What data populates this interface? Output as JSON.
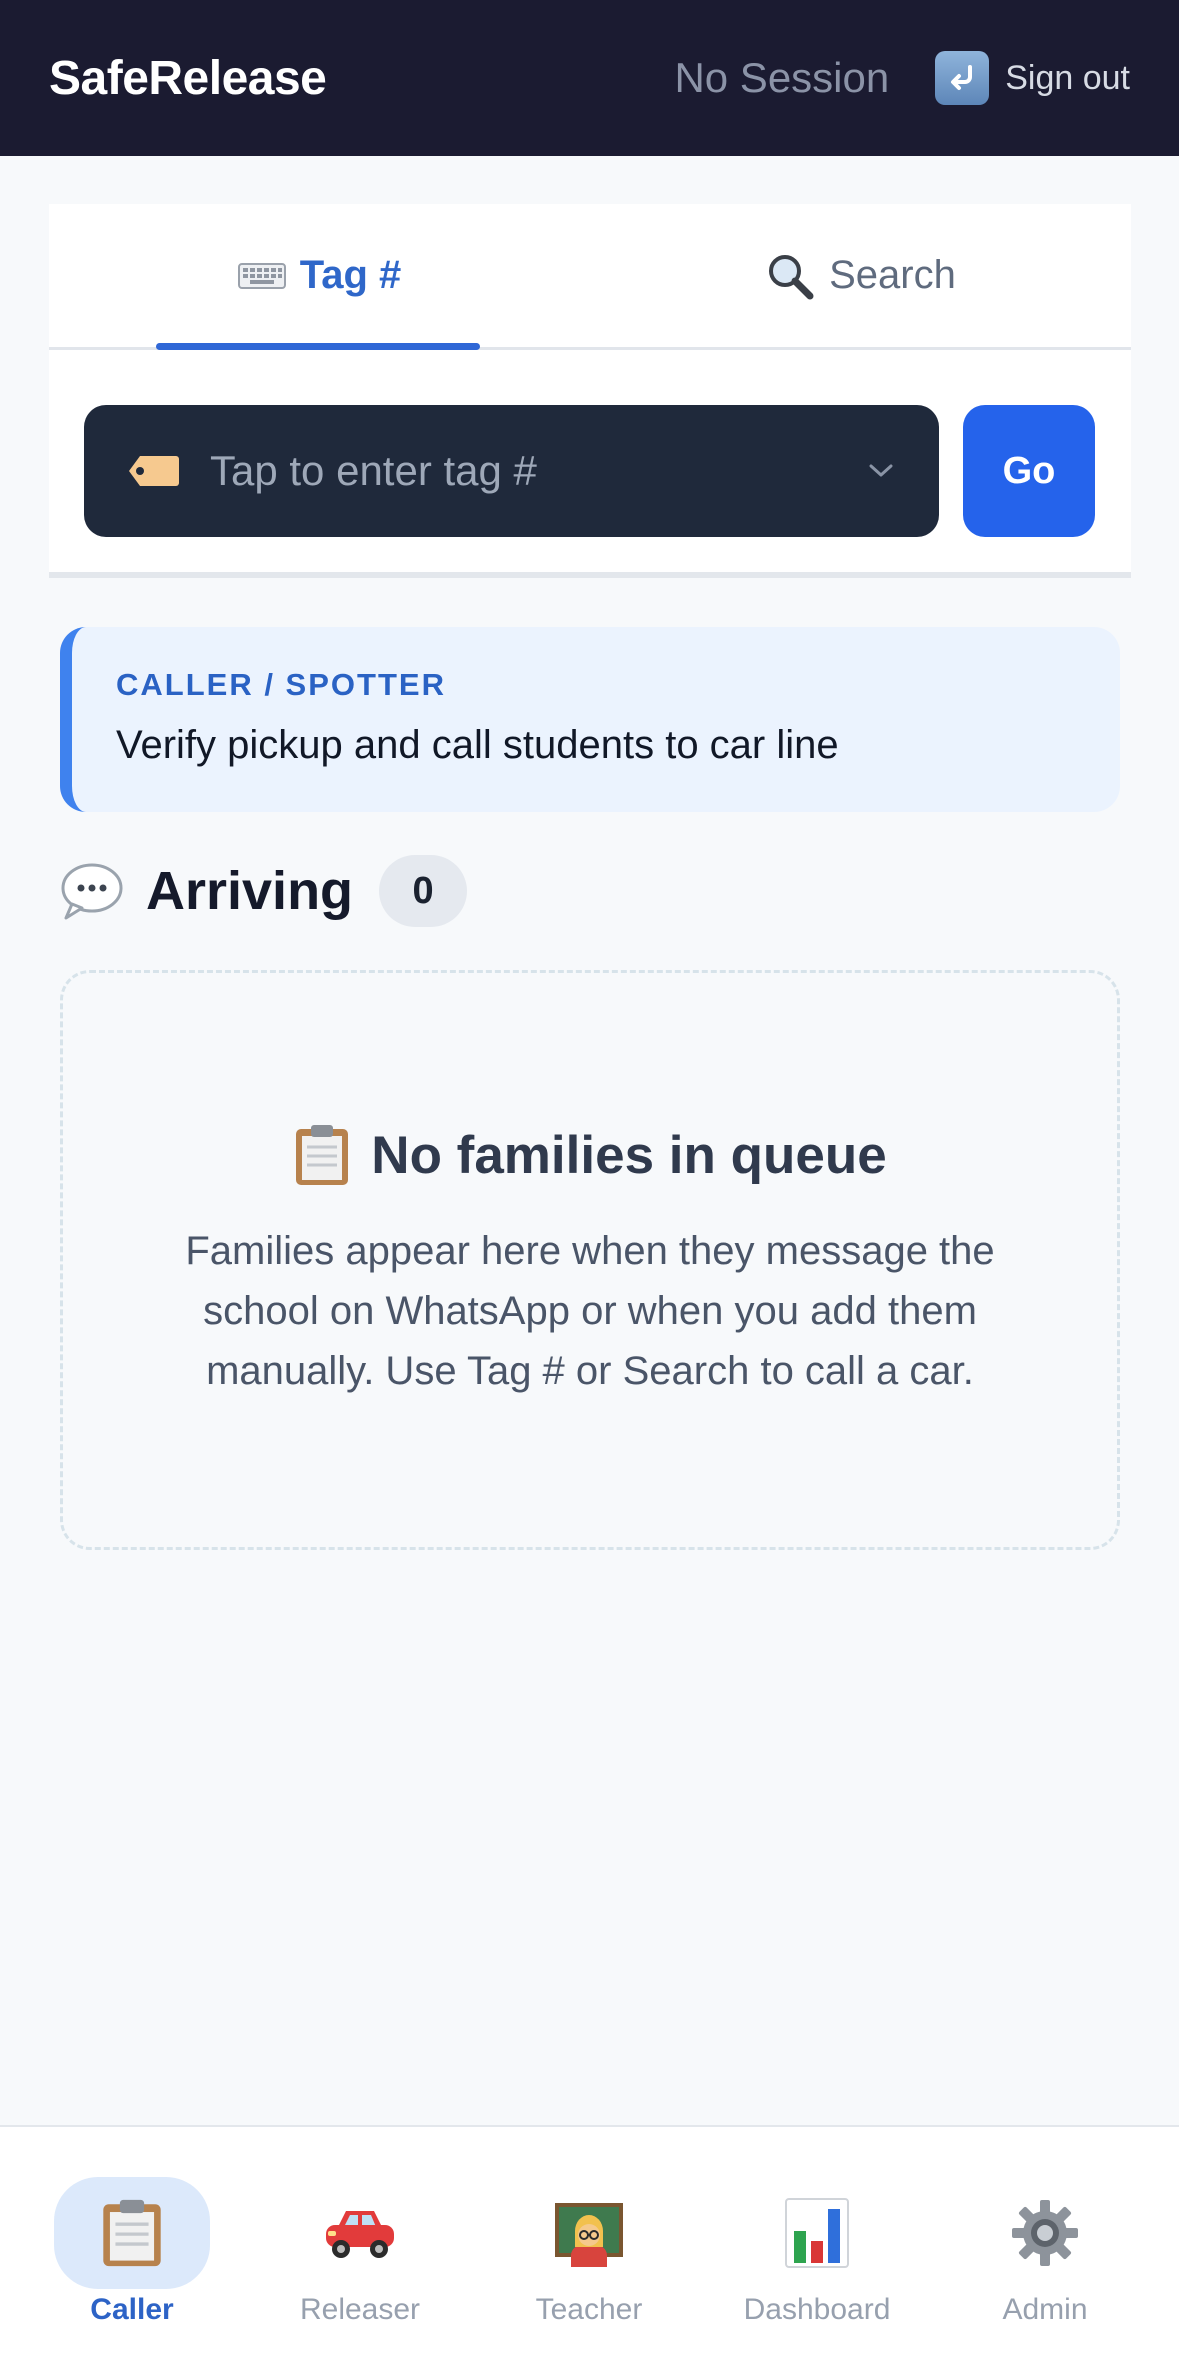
{
  "header": {
    "app_title": "SafeRelease",
    "session_status": "No Session",
    "signout_label": "Sign out",
    "signout_icon": "return-arrow-icon"
  },
  "tabs": [
    {
      "label": "Tag #",
      "icon": "keyboard-icon",
      "active": true
    },
    {
      "label": "Search",
      "icon": "magnifier-icon",
      "active": false
    }
  ],
  "tag_input": {
    "placeholder": "Tap to enter tag #",
    "icon": "tag-icon",
    "go_label": "Go"
  },
  "role": {
    "kicker": "CALLER / SPOTTER",
    "description": "Verify pickup and call students to car line"
  },
  "arriving": {
    "title": "Arriving",
    "count": "0",
    "icon": "speech-bubble-icon"
  },
  "empty_state": {
    "title": "No families in queue",
    "icon": "clipboard-icon",
    "text": "Families appear here when they message the school on WhatsApp or when you add them manually. Use Tag # or Search to call a car."
  },
  "nav": [
    {
      "label": "Caller",
      "icon": "clipboard-icon",
      "active": true
    },
    {
      "label": "Releaser",
      "icon": "car-icon",
      "active": false
    },
    {
      "label": "Teacher",
      "icon": "teacher-icon",
      "active": false
    },
    {
      "label": "Dashboard",
      "icon": "bar-chart-icon",
      "active": false
    },
    {
      "label": "Admin",
      "icon": "gear-icon",
      "active": false
    }
  ],
  "colors": {
    "header_bg": "#1b1b31",
    "accent": "#2563eb",
    "input_bg": "#1f293b",
    "role_bg": "#ebf3fe"
  }
}
